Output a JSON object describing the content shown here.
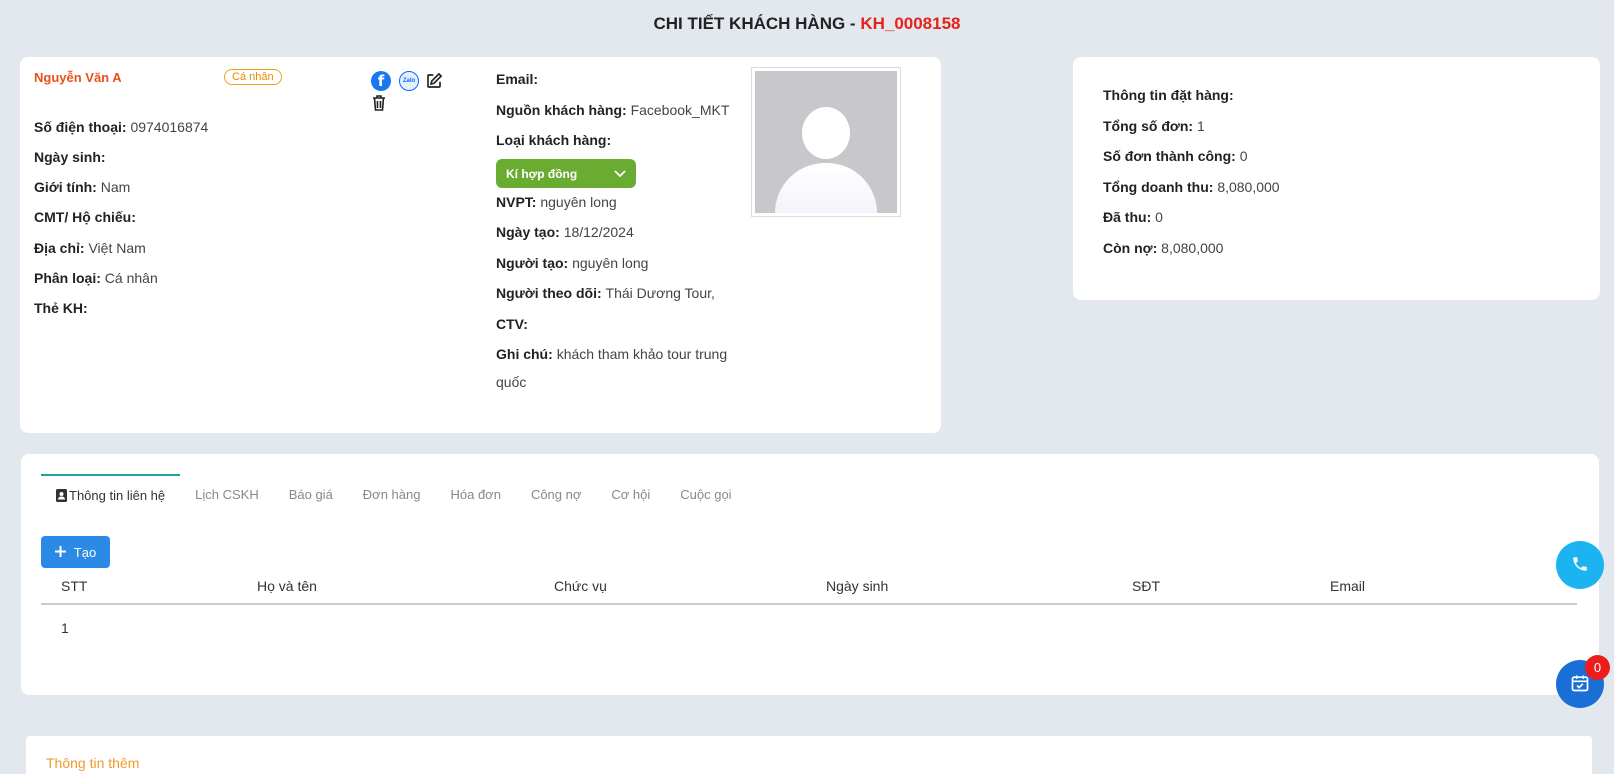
{
  "header": {
    "title_prefix": "CHI TIẾT KHÁCH HÀNG - ",
    "customer_code": "KH_0008158"
  },
  "profile": {
    "name": "Nguyễn Văn A",
    "type_badge": "Cá nhân",
    "fields_left": [
      {
        "label": "Số điện thoại",
        "value": "0974016874"
      },
      {
        "label": "Ngày sinh",
        "value": ""
      },
      {
        "label": "Giới tính",
        "value": "Nam"
      },
      {
        "label": "CMT/ Hộ chiếu",
        "value": ""
      },
      {
        "label": "Địa chỉ",
        "value": "Việt Nam"
      },
      {
        "label": "Phân loại",
        "value": "Cá nhân"
      },
      {
        "label": "Thẻ KH",
        "value": ""
      }
    ],
    "email_label": "Email",
    "email_value": "",
    "source_label": "Nguồn khách hàng",
    "source_value": "Facebook_MKT",
    "customer_type_label": "Loại khách hàng",
    "customer_type_value": "Kí hợp đồng",
    "nvpt_label": "NVPT",
    "nvpt_value": "nguyên long",
    "created_date_label": "Ngày tạo",
    "created_date_value": "18/12/2024",
    "creator_label": "Người tạo",
    "creator_value": "nguyên long",
    "follower_label": "Người theo dõi",
    "follower_value": "Thái Dương Tour,",
    "ctv_label": "CTV",
    "ctv_value": "",
    "note_label": "Ghi chú",
    "note_value_line1": "khách tham khảo tour trung",
    "note_value_line2": "quốc",
    "icons": {
      "facebook": "facebook-icon",
      "zalo": "zalo-icon",
      "edit": "edit-icon",
      "delete": "trash-icon"
    },
    "zalo_text": "Zalo",
    "fb_text": "f"
  },
  "order_info": {
    "title": "Thông tin đặt hàng",
    "fields": [
      {
        "label": "Tổng số đơn",
        "value": "1"
      },
      {
        "label": "Số đơn thành công",
        "value": "0"
      },
      {
        "label": "Tổng doanh thu",
        "value": "8,080,000"
      },
      {
        "label": "Đã thu",
        "value": "0"
      },
      {
        "label": "Còn nợ",
        "value": "8,080,000"
      }
    ]
  },
  "tabs": [
    {
      "label": "Thông tin liên hệ",
      "active": true
    },
    {
      "label": "Lịch CSKH"
    },
    {
      "label": "Báo giá"
    },
    {
      "label": "Đơn hàng"
    },
    {
      "label": "Hóa đơn"
    },
    {
      "label": "Công nợ"
    },
    {
      "label": "Cơ hội"
    },
    {
      "label": "Cuộc gọi"
    }
  ],
  "create_button": "Tạo",
  "table": {
    "headers": [
      "STT",
      "Họ và tên",
      "Chức vụ",
      "Ngày sinh",
      "SĐT",
      "Email"
    ],
    "rows": [
      [
        "1",
        "",
        "",
        "",
        "",
        ""
      ]
    ]
  },
  "extra_section_title": "Thông tin thêm",
  "notification_count": "0",
  "colors": {
    "accent_red": "#e8211b",
    "accent_green": "#6aab32",
    "primary_blue": "#2b8ae6",
    "tab_underline": "#1ea69a",
    "orange": "#f09a2a"
  }
}
